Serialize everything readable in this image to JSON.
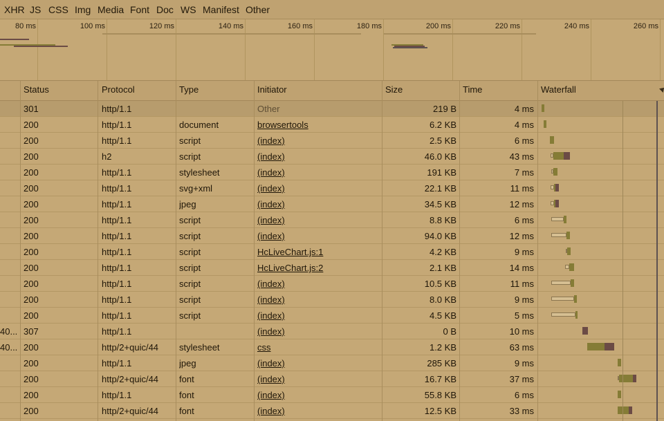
{
  "filters": [
    "XHR",
    "JS",
    "CSS",
    "Img",
    "Media",
    "Font",
    "Doc",
    "WS",
    "Manifest",
    "Other"
  ],
  "timeline_ticks": [
    "80 ms",
    "100 ms",
    "120 ms",
    "140 ms",
    "160 ms",
    "180 ms",
    "200 ms",
    "220 ms",
    "240 ms",
    "260 ms"
  ],
  "columns": {
    "status": "Status",
    "protocol": "Protocol",
    "type": "Type",
    "initiator": "Initiator",
    "size": "Size",
    "time": "Time",
    "waterfall": "Waterfall"
  },
  "rows": [
    {
      "name": "",
      "status": "301",
      "protocol": "http/1.1",
      "type": "",
      "initiator": "Other",
      "size": "219 B",
      "time": "4 ms"
    },
    {
      "name": "",
      "status": "200",
      "protocol": "http/1.1",
      "type": "document",
      "initiator": "browsertools",
      "size": "6.2 KB",
      "time": "4 ms"
    },
    {
      "name": "",
      "status": "200",
      "protocol": "http/1.1",
      "type": "script",
      "initiator": "(index)",
      "size": "2.5 KB",
      "time": "6 ms"
    },
    {
      "name": "",
      "status": "200",
      "protocol": "h2",
      "type": "script",
      "initiator": "(index)",
      "size": "46.0 KB",
      "time": "43 ms"
    },
    {
      "name": "",
      "status": "200",
      "protocol": "http/1.1",
      "type": "stylesheet",
      "initiator": "(index)",
      "size": "191 KB",
      "time": "7 ms"
    },
    {
      "name": "",
      "status": "200",
      "protocol": "http/1.1",
      "type": "svg+xml",
      "initiator": "(index)",
      "size": "22.1 KB",
      "time": "11 ms"
    },
    {
      "name": "",
      "status": "200",
      "protocol": "http/1.1",
      "type": "jpeg",
      "initiator": "(index)",
      "size": "34.5 KB",
      "time": "12 ms"
    },
    {
      "name": "",
      "status": "200",
      "protocol": "http/1.1",
      "type": "script",
      "initiator": "(index)",
      "size": "8.8 KB",
      "time": "6 ms"
    },
    {
      "name": "",
      "status": "200",
      "protocol": "http/1.1",
      "type": "script",
      "initiator": "(index)",
      "size": "94.0 KB",
      "time": "12 ms"
    },
    {
      "name": "",
      "status": "200",
      "protocol": "http/1.1",
      "type": "script",
      "initiator": "HcLiveChart.js:1",
      "size": "4.2 KB",
      "time": "9 ms"
    },
    {
      "name": "",
      "status": "200",
      "protocol": "http/1.1",
      "type": "script",
      "initiator": "HcLiveChart.js:2",
      "size": "2.1 KB",
      "time": "14 ms"
    },
    {
      "name": "",
      "status": "200",
      "protocol": "http/1.1",
      "type": "script",
      "initiator": "(index)",
      "size": "10.5 KB",
      "time": "11 ms"
    },
    {
      "name": "",
      "status": "200",
      "protocol": "http/1.1",
      "type": "script",
      "initiator": "(index)",
      "size": "8.0 KB",
      "time": "9 ms"
    },
    {
      "name": "",
      "status": "200",
      "protocol": "http/1.1",
      "type": "script",
      "initiator": "(index)",
      "size": "4.5 KB",
      "time": "5 ms"
    },
    {
      "name": "40...",
      "status": "307",
      "protocol": "http/1.1",
      "type": "",
      "initiator": "(index)",
      "size": "0 B",
      "time": "10 ms"
    },
    {
      "name": "40...",
      "status": "200",
      "protocol": "http/2+quic/44",
      "type": "stylesheet",
      "initiator": "css",
      "size": "1.2 KB",
      "time": "63 ms"
    },
    {
      "name": "",
      "status": "200",
      "protocol": "http/1.1",
      "type": "jpeg",
      "initiator": "(index)",
      "size": "285 KB",
      "time": "9 ms"
    },
    {
      "name": "",
      "status": "200",
      "protocol": "http/2+quic/44",
      "type": "font",
      "initiator": "(index)",
      "size": "16.7 KB",
      "time": "37 ms"
    },
    {
      "name": "",
      "status": "200",
      "protocol": "http/1.1",
      "type": "font",
      "initiator": "(index)",
      "size": "55.8 KB",
      "time": "6 ms"
    },
    {
      "name": "",
      "status": "200",
      "protocol": "http/2+quic/44",
      "type": "font",
      "initiator": "(index)",
      "size": "12.5 KB",
      "time": "33 ms"
    }
  ],
  "colors": {
    "background": "#c5a876",
    "waiting": "#d6bf92",
    "ttfb": "#857c36",
    "download": "#6b4b45"
  }
}
